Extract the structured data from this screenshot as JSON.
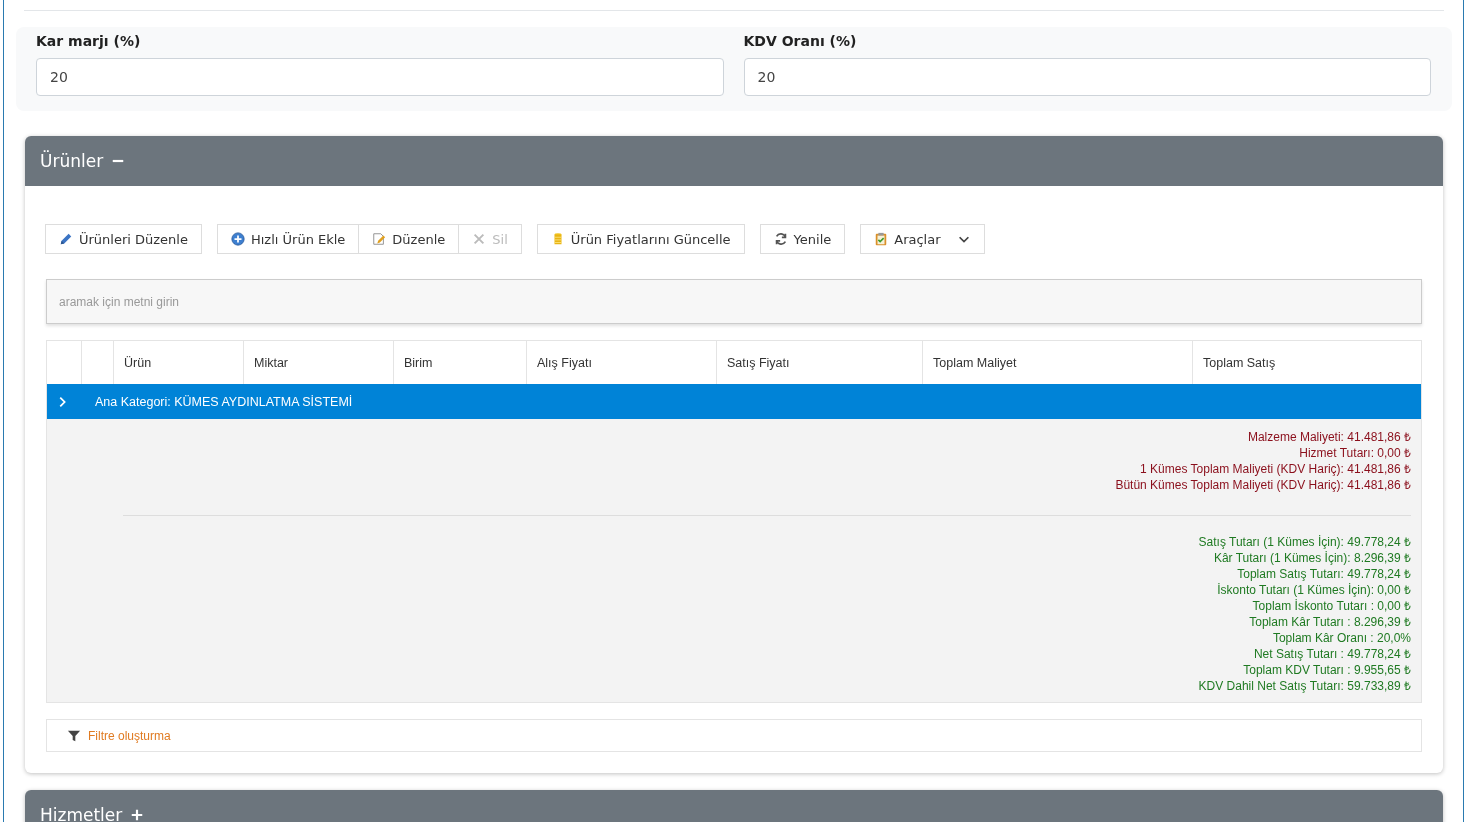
{
  "fields": [
    {
      "label": "Kar marjı (%)",
      "value": "20"
    },
    {
      "label": "KDV Oranı (%)",
      "value": "20"
    }
  ],
  "panels": [
    {
      "title": "Ürünler",
      "expanded": true,
      "toolbar": [
        {
          "group": [
            {
              "label": "Ürünleri Düzenle",
              "kind": "pencil",
              "disabled": false
            }
          ]
        },
        {
          "group": [
            {
              "label": "Hızlı Ürün Ekle",
              "kind": "plus",
              "disabled": false
            },
            {
              "label": "Düzenle",
              "kind": "edit",
              "disabled": false
            },
            {
              "label": "Sil",
              "kind": "x",
              "disabled": true
            }
          ]
        },
        {
          "group": [
            {
              "label": "Ürün Fiyatlarını Güncelle",
              "kind": "coins",
              "disabled": false
            }
          ]
        },
        {
          "group": [
            {
              "label": "Yenile",
              "kind": "refresh",
              "disabled": false
            }
          ]
        },
        {
          "group": [
            {
              "label": "Araçlar",
              "kind": "clipboard",
              "disabled": false,
              "dropdown": true
            }
          ]
        }
      ],
      "search": {
        "placeholder": "aramak için metni girin"
      },
      "table": {
        "columns": [
          "Ürün",
          "Miktar",
          "Birim",
          "Alış Fiyatı",
          "Satış Fiyatı",
          "Toplam Maliyet",
          "Toplam Satış"
        ],
        "group_row": {
          "label": "Ana Kategori: KÜMES AYDINLATMA SİSTEMİ",
          "expanded": false
        },
        "summary": [
          {
            "kind": "cost",
            "lines": [
              "Malzeme Maliyeti: 41.481,86 ₺",
              "Hizmet Tutarı: 0,00 ₺",
              "1 Kümes Toplam Maliyeti (KDV Hariç): 41.481,86 ₺",
              "Bütün Kümes Toplam Maliyeti (KDV Hariç): 41.481,86 ₺"
            ]
          },
          {
            "kind": "sales",
            "lines": [
              "Satış Tutarı (1 Kümes İçin): 49.778,24 ₺",
              "Kâr Tutarı (1 Kümes İçin): 8.296,39 ₺",
              "Toplam Satış Tutarı: 49.778,24 ₺",
              "İskonto Tutarı (1 Kümes İçin): 0,00 ₺",
              "Toplam İskonto Tutarı : 0,00 ₺",
              "Toplam Kâr Tutarı : 8.296,39 ₺",
              "Toplam Kâr Oranı : 20,0%",
              "Net Satış Tutarı : 49.778,24 ₺",
              "Toplam KDV Tutarı : 9.955,65 ₺",
              "KDV Dahil Net Satış Tutarı: 59.733,89 ₺"
            ]
          }
        ]
      },
      "filter": {
        "label": "Filtre oluşturma"
      }
    },
    {
      "title": "Hizmetler",
      "expanded": false
    }
  ]
}
